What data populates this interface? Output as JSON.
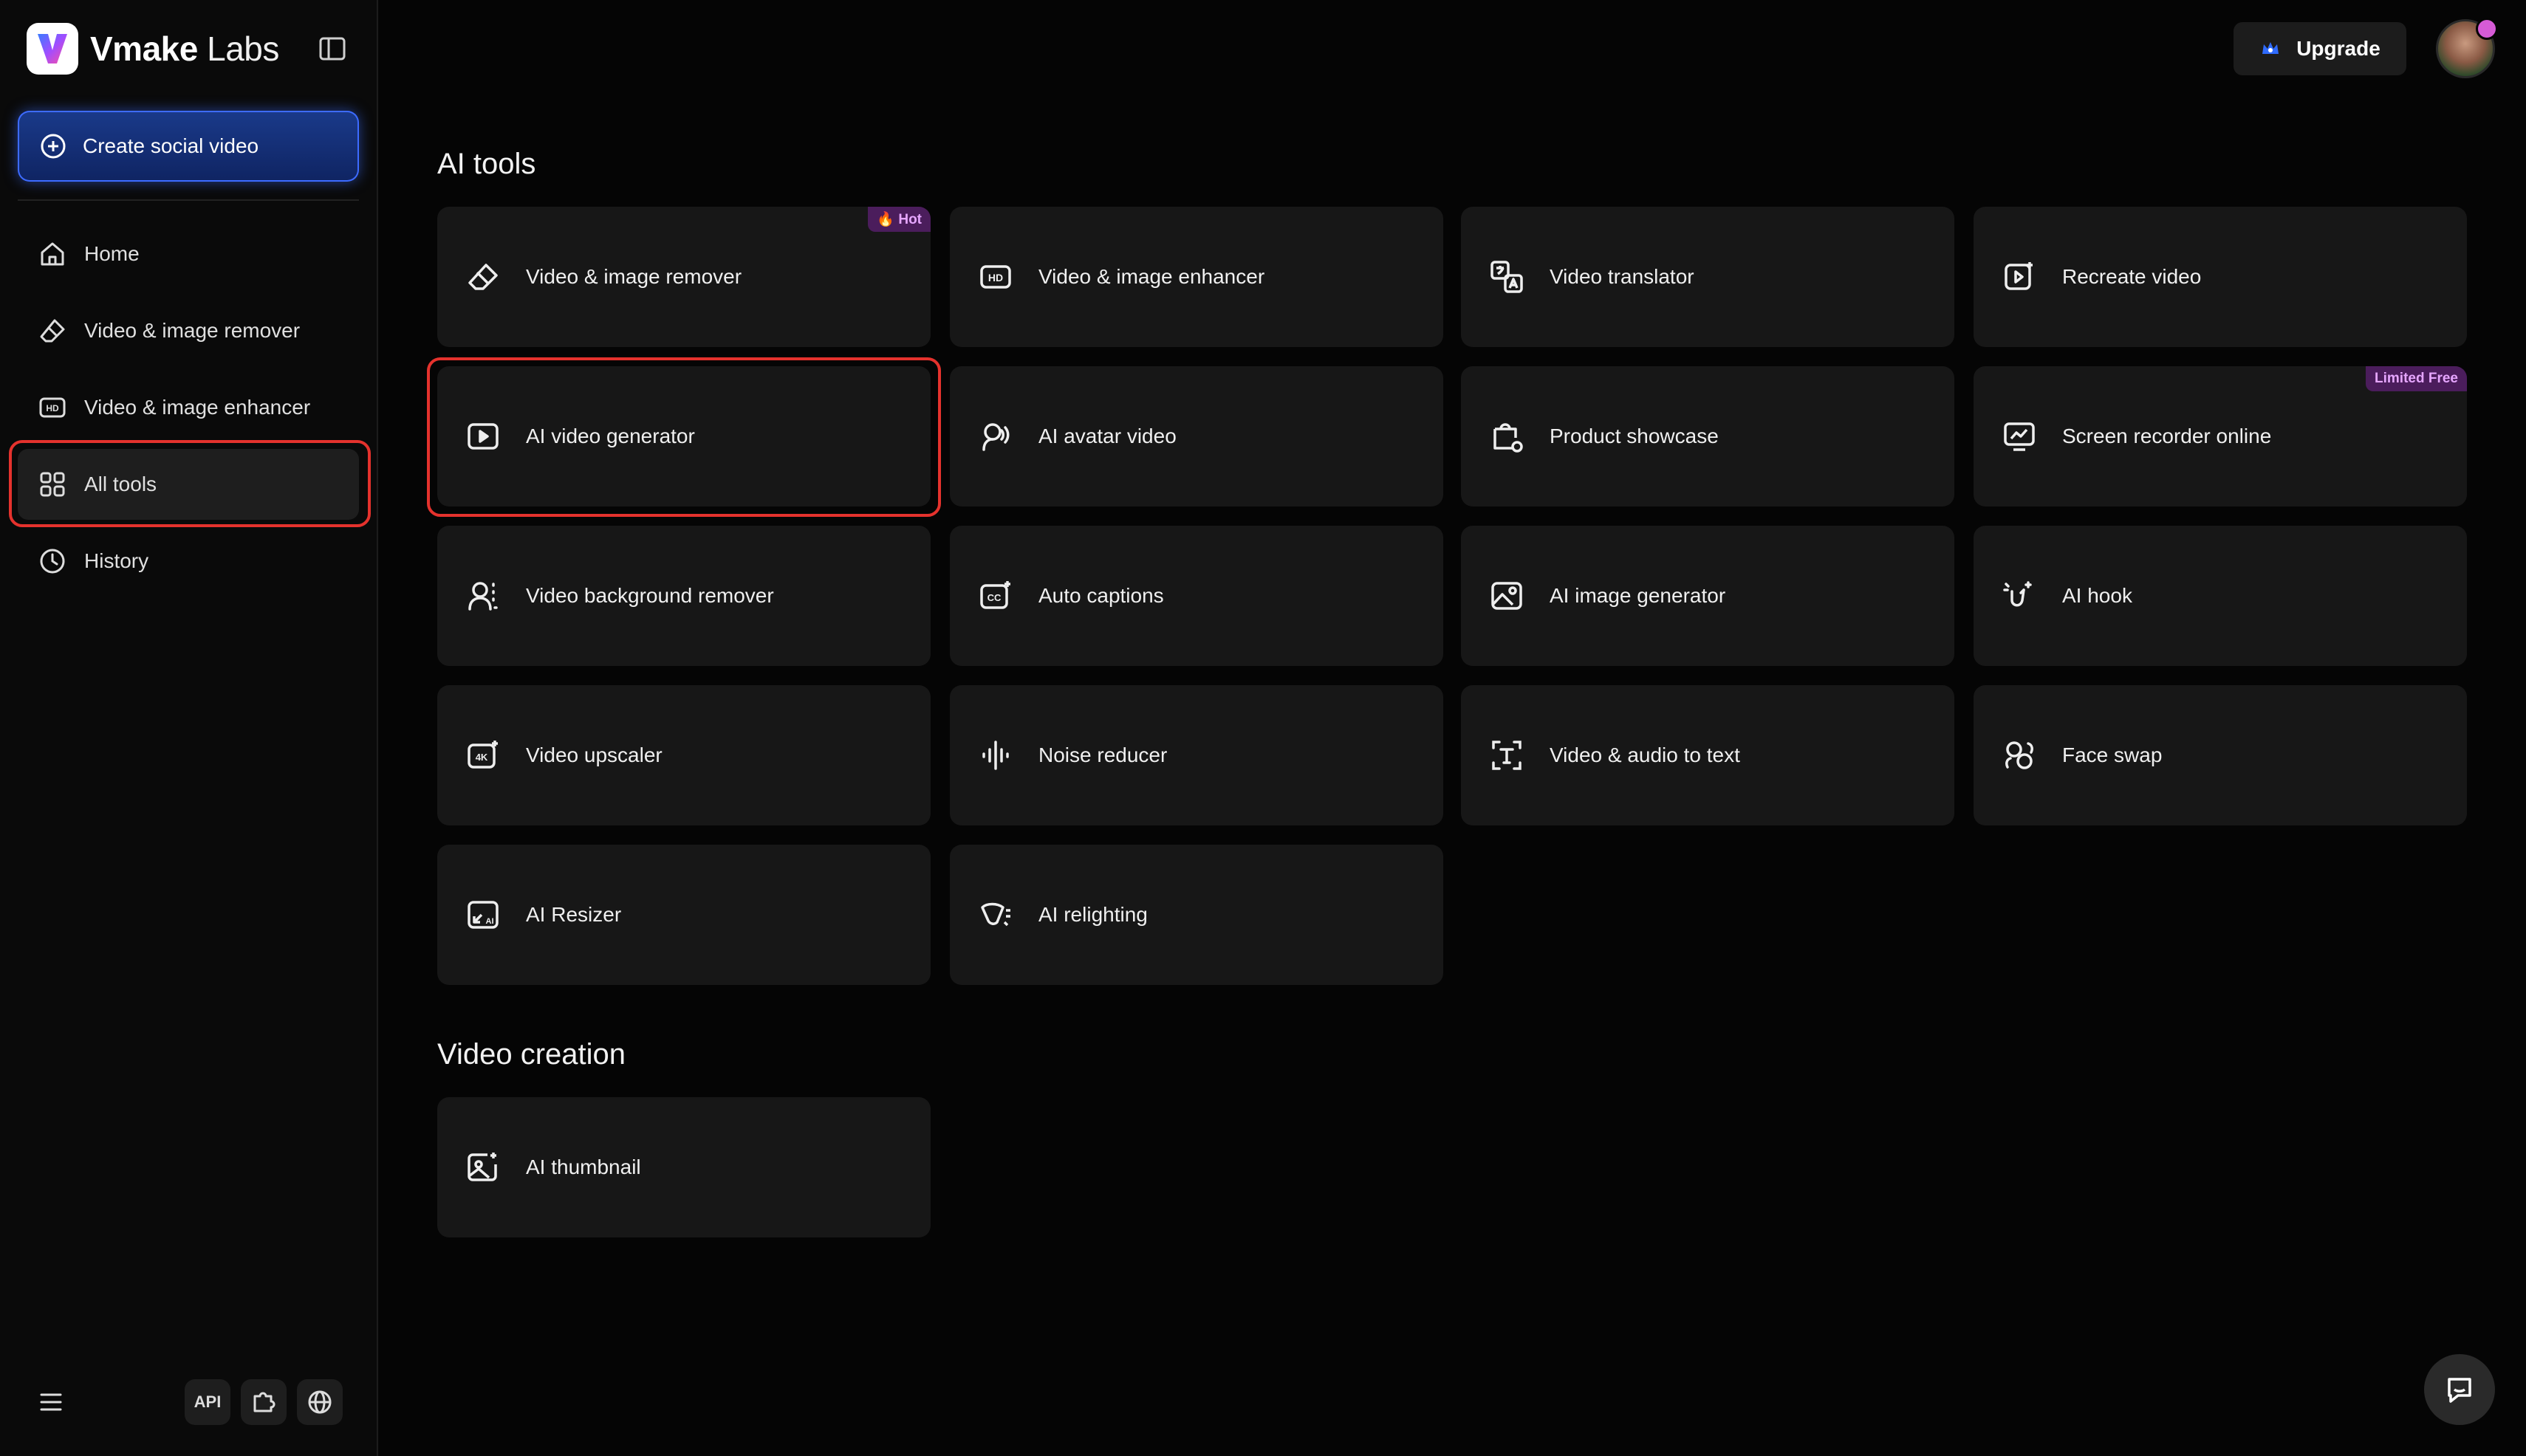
{
  "app": {
    "brand_bold": "Vmake",
    "brand_light": " Labs"
  },
  "sidebar": {
    "create_label": "Create social video",
    "items": [
      {
        "label": "Home",
        "icon": "home-icon"
      },
      {
        "label": "Video & image remover",
        "icon": "eraser-icon"
      },
      {
        "label": "Video & image enhancer",
        "icon": "hd-icon"
      },
      {
        "label": "All tools",
        "icon": "grid-icon",
        "active": true
      },
      {
        "label": "History",
        "icon": "clock-icon"
      }
    ],
    "api_label": "API"
  },
  "header": {
    "upgrade_label": "Upgrade"
  },
  "ai_tools": {
    "title": "AI tools",
    "cards": [
      {
        "label": "Video & image remover",
        "icon": "eraser-icon",
        "badge": "🔥 Hot"
      },
      {
        "label": "Video & image enhancer",
        "icon": "hd-icon"
      },
      {
        "label": "Video translator",
        "icon": "translate-icon"
      },
      {
        "label": "Recreate video",
        "icon": "recreate-icon"
      },
      {
        "label": "AI video generator",
        "icon": "play-icon",
        "highlighted": true
      },
      {
        "label": "AI avatar video",
        "icon": "avatar-voice-icon"
      },
      {
        "label": "Product showcase",
        "icon": "product-icon"
      },
      {
        "label": "Screen recorder online",
        "icon": "screen-recorder-icon",
        "badge": "Limited Free"
      },
      {
        "label": "Video background remover",
        "icon": "person-background-icon"
      },
      {
        "label": "Auto captions",
        "icon": "captions-icon"
      },
      {
        "label": "AI image generator",
        "icon": "image-icon"
      },
      {
        "label": "AI hook",
        "icon": "hook-icon"
      },
      {
        "label": "Video upscaler",
        "icon": "4k-icon"
      },
      {
        "label": "Noise reducer",
        "icon": "noise-icon"
      },
      {
        "label": "Video & audio to text",
        "icon": "text-icon"
      },
      {
        "label": "Face swap",
        "icon": "face-swap-icon"
      },
      {
        "label": "AI Resizer",
        "icon": "resize-icon"
      },
      {
        "label": "AI relighting",
        "icon": "relight-icon"
      }
    ]
  },
  "video_creation": {
    "title": "Video creation",
    "cards": [
      {
        "label": "AI thumbnail",
        "icon": "thumbnail-icon"
      }
    ]
  },
  "colors": {
    "accent_blue": "#3d6bff",
    "highlight_red": "#e5322d",
    "badge_purple": "#e6a6ff"
  }
}
